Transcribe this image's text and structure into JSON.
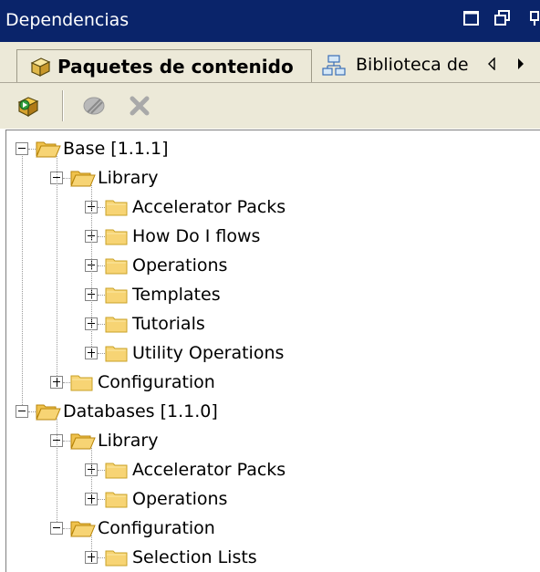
{
  "window": {
    "title": "Dependencias"
  },
  "tabs": {
    "active_label": "Paquetes de contenido",
    "second_label": "Biblioteca de"
  },
  "tree": {
    "nodes": [
      {
        "label": "Base [1.1.1]",
        "level": 0,
        "expanded": true
      },
      {
        "label": "Library",
        "level": 1,
        "expanded": true
      },
      {
        "label": "Accelerator Packs",
        "level": 2,
        "expanded": false
      },
      {
        "label": "How Do I flows",
        "level": 2,
        "expanded": false
      },
      {
        "label": "Operations",
        "level": 2,
        "expanded": false
      },
      {
        "label": "Templates",
        "level": 2,
        "expanded": false
      },
      {
        "label": "Tutorials",
        "level": 2,
        "expanded": false
      },
      {
        "label": "Utility Operations",
        "level": 2,
        "expanded": false
      },
      {
        "label": "Configuration",
        "level": 1,
        "expanded": false
      },
      {
        "label": "Databases [1.1.0]",
        "level": 0,
        "expanded": true
      },
      {
        "label": "Library",
        "level": 1,
        "expanded": true
      },
      {
        "label": "Accelerator Packs",
        "level": 2,
        "expanded": false
      },
      {
        "label": "Operations",
        "level": 2,
        "expanded": false
      },
      {
        "label": "Configuration",
        "level": 1,
        "expanded": true
      },
      {
        "label": "Selection Lists",
        "level": 2,
        "expanded": false
      }
    ]
  },
  "colors": {
    "titlebar": "#0a246a",
    "chrome": "#ece9d8",
    "folder": "#f7d474"
  }
}
